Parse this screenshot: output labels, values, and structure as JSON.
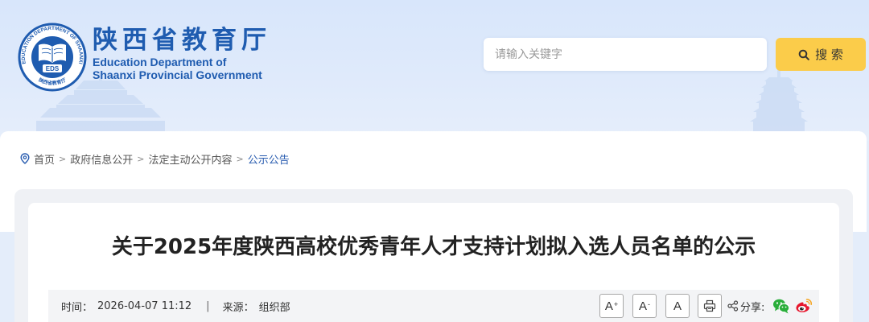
{
  "header": {
    "logo": {
      "ring_text": "EDUCATION DEPARTMENT OF SHAANXI",
      "bottom_text": "陕西省教育厅",
      "center_text": "EDS"
    },
    "site_name_cn": "陕西省教育厅",
    "site_name_en_line1": "Education Department of",
    "site_name_en_line2": "Shaanxi Provincial Government"
  },
  "search": {
    "placeholder": "请输入关键字",
    "value": "",
    "button_label": "搜 索",
    "button_icon": "search-icon"
  },
  "breadcrumb": {
    "icon": "location-pin-icon",
    "separator": ">",
    "items": [
      "首页",
      "政府信息公开",
      "法定主动公开内容",
      "公示公告"
    ]
  },
  "article": {
    "title": "关于2025年度陕西高校优秀青年人才支持计划拟入选人员名单的公示",
    "meta": {
      "time_label": "时间：",
      "time_value": "2026-04-07 11:12",
      "divider": "|",
      "source_label": "来源：",
      "source_value": "组织部"
    },
    "tools": {
      "font_larger": {
        "letter": "A",
        "mark": "+"
      },
      "font_smaller": {
        "letter": "A",
        "mark": "-"
      },
      "font_reset": {
        "letter": "A"
      },
      "print_icon": "print-icon",
      "share_icon": "share-icon",
      "share_label": "分享:",
      "share_targets": [
        "wechat-icon",
        "weibo-icon"
      ]
    }
  },
  "colors": {
    "brand_blue": "#1f5cb0",
    "search_button_yellow": "#fbcc4a",
    "breadcrumb_active": "#2a5db0",
    "meta_bar_bg": "#f3f4f6",
    "wechat_green": "#2aae3b",
    "weibo_red": "#e6162d"
  }
}
